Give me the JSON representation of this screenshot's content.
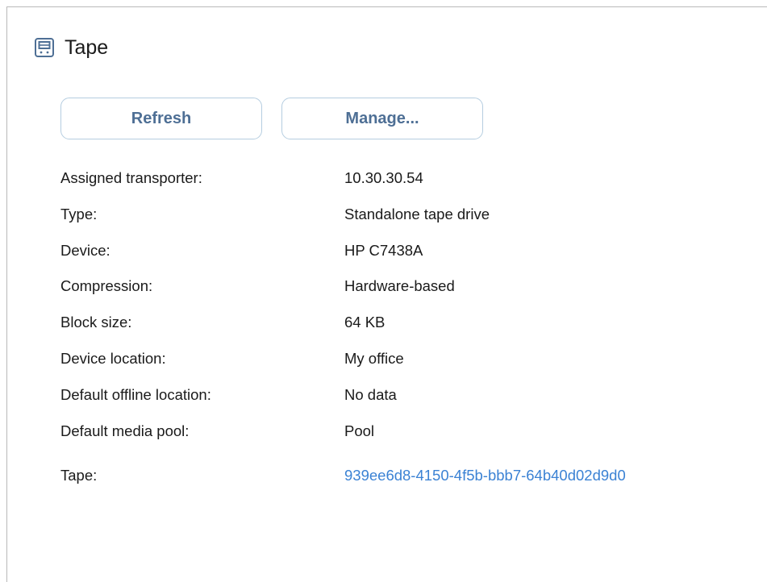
{
  "header": {
    "title": "Tape",
    "icon": "tape-drive-icon"
  },
  "toolbar": {
    "refresh_label": "Refresh",
    "manage_label": "Manage..."
  },
  "details": [
    {
      "label": "Assigned transporter:",
      "value": "10.30.30.54"
    },
    {
      "label": "Type:",
      "value": "Standalone tape drive"
    },
    {
      "label": "Device:",
      "value": "HP C7438A"
    },
    {
      "label": "Compression:",
      "value": "Hardware-based"
    },
    {
      "label": "Block size:",
      "value": "64 KB"
    },
    {
      "label": "Device location:",
      "value": "My office"
    },
    {
      "label": "Default offline location:",
      "value": "No data"
    },
    {
      "label": "Default media pool:",
      "value": "Pool"
    },
    {
      "label": "Tape:",
      "value": "939ee6d8-4150-4f5b-bbb7-64b40d02d9d0"
    }
  ],
  "colors": {
    "accent": "#4e6f95",
    "link": "#3b82d4",
    "button_border": "#b5cde0"
  }
}
